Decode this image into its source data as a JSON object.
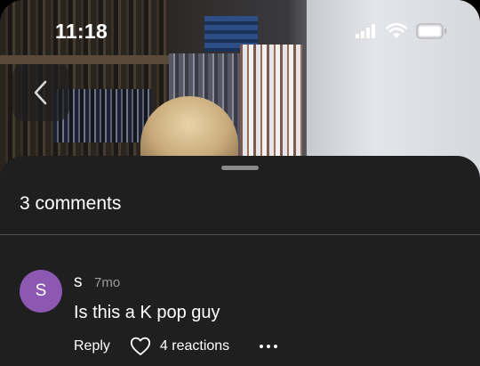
{
  "status_bar": {
    "time": "11:18",
    "signal_icon": "cellular-signal-icon",
    "wifi_icon": "wifi-icon",
    "battery_icon": "battery-icon"
  },
  "video": {
    "back_icon": "chevron-left-icon"
  },
  "comments": {
    "title": "3 comments",
    "items": [
      {
        "avatar_initial": "S",
        "avatar_color": "#8c58b2",
        "author": "s",
        "time": "7mo",
        "text": "Is this a K pop guy",
        "reply_label": "Reply",
        "reaction_icon": "heart-icon",
        "reactions_label": "4 reactions",
        "more_icon": "more-options-icon"
      }
    ]
  },
  "colors": {
    "sheet_bg": "#1f1f20",
    "divider": "#505054",
    "muted_text": "#9a9a9e"
  }
}
